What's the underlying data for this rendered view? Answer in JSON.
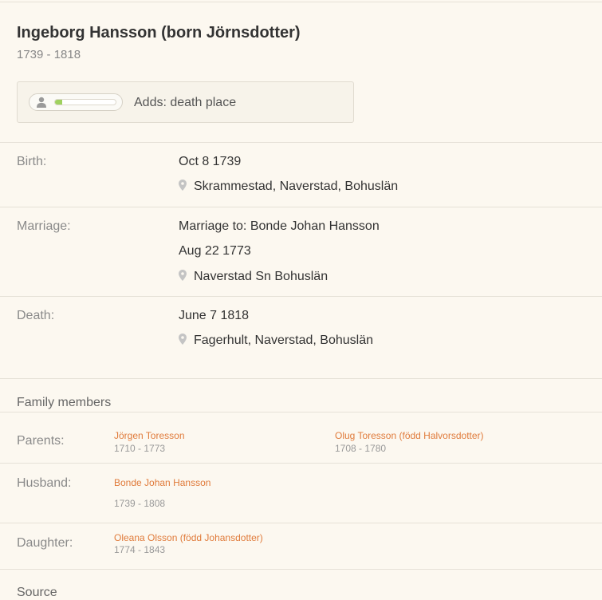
{
  "person": {
    "name": "Ingeborg Hansson (born Jörnsdotter)",
    "years": "1739 - 1818"
  },
  "contribution": {
    "text": "Adds: death place",
    "progress_fraction": 0.12,
    "bar_color": "#9fd15f"
  },
  "events": {
    "birth": {
      "label": "Birth:",
      "date": "Oct 8 1739",
      "place": "Skrammestad, Naverstad, Bohuslän"
    },
    "marriage": {
      "label": "Marriage:",
      "spouse": "Marriage to: Bonde Johan Hansson",
      "date": "Aug 22 1773",
      "place": "Naverstad Sn Bohuslän"
    },
    "death": {
      "label": "Death:",
      "date": "June 7 1818",
      "place": "Fagerhult, Naverstad, Bohuslän"
    }
  },
  "family": {
    "heading": "Family members",
    "parents": {
      "label": "Parents:",
      "father_name": "Jörgen Toresson",
      "father_years": "1710 - 1773",
      "mother_name": "Olug Toresson (född Halvorsdotter)",
      "mother_years": "1708 - 1780"
    },
    "husband": {
      "label": "Husband:",
      "name": "Bonde Johan Hansson",
      "years": "1739 - 1808"
    },
    "daughter": {
      "label": "Daughter:",
      "name": "Oleana Olsson (född Johansdotter)",
      "years": "1774 - 1843"
    }
  },
  "source": {
    "heading": "Source"
  },
  "colors": {
    "background": "#fcf8f0",
    "link": "#e07b3b",
    "label": "#8a8a8a"
  }
}
